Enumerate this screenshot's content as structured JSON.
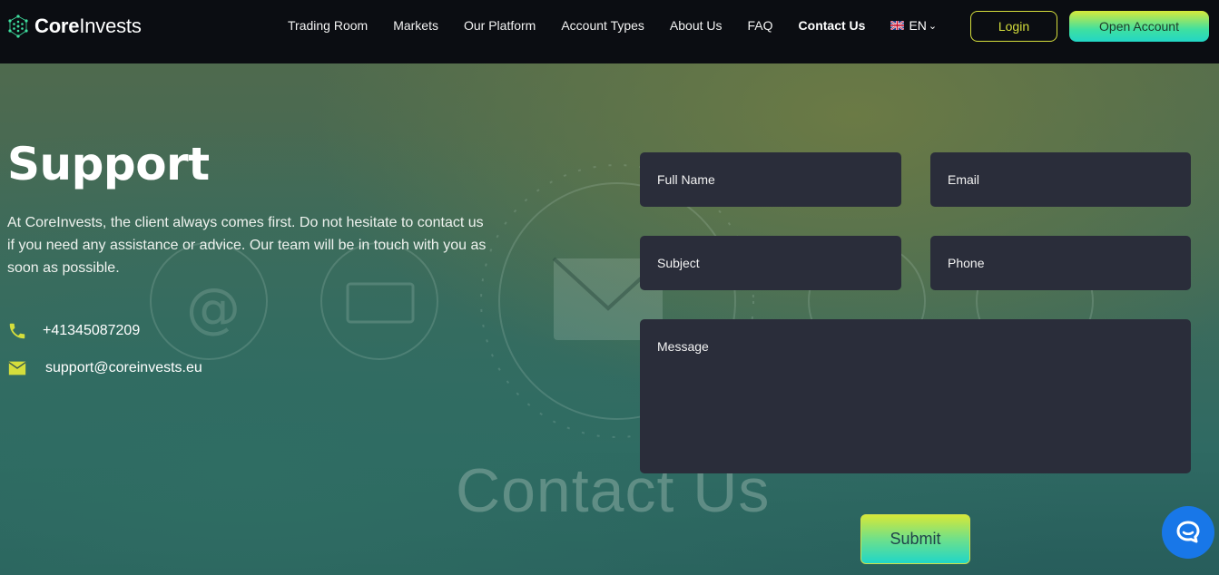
{
  "brand": {
    "name_bold": "Core",
    "name_rest": "Invests"
  },
  "nav": {
    "items": [
      "Trading Room",
      "Markets",
      "Our Platform",
      "Account Types",
      "About Us",
      "FAQ",
      "Contact Us"
    ],
    "active": "Contact Us",
    "language": "EN"
  },
  "header": {
    "login_label": "Login",
    "open_account_label": "Open Account"
  },
  "hero": {
    "title": "Support",
    "description": "At CoreInvests, the client always comes first. Do not hesitate to contact us if you need any assistance or advice. Our team will be in touch with you as soon as possible.",
    "phone": "+41345087209",
    "email": "support@coreinvests.eu",
    "watermark": "Contact Us"
  },
  "form": {
    "full_name_placeholder": "Full Name",
    "email_placeholder": "Email",
    "subject_placeholder": "Subject",
    "phone_placeholder": "Phone",
    "message_placeholder": "Message",
    "submit_label": "Submit"
  },
  "colors": {
    "accent_yellow": "#d5de3c",
    "accent_teal": "#22d6c6",
    "field_bg": "#2a2d3a",
    "chat_blue": "#1877e8"
  },
  "icons": {
    "logo": "hexagon-network-icon",
    "phone": "phone-icon",
    "mail": "mail-icon",
    "chat": "chat-bubble-icon",
    "flag": "uk-flag-icon",
    "dropdown": "chevron-down-icon"
  }
}
